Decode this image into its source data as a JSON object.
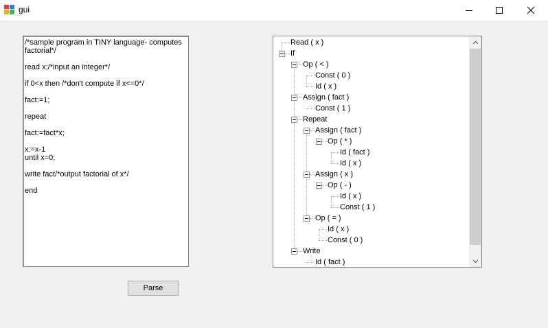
{
  "window": {
    "title": "gui"
  },
  "source": {
    "lines": [
      "/*sample program in TINY language- computes factorial*/",
      "",
      "read x;/*input an integer*/",
      "",
      "if 0<x then /*don't compute if x<=0*/",
      "",
      "fact:=1;",
      "",
      "repeat",
      "",
      "fact:=fact*x;",
      "",
      "x:=x-1",
      "until x=0;",
      "",
      "write fact/*output factorial of x*/",
      "",
      "end"
    ]
  },
  "parse_button": {
    "label": "Parse"
  },
  "tree": {
    "nodes": [
      {
        "label": "Read ( x )",
        "depth": 0,
        "expanded": false
      },
      {
        "label": "If",
        "depth": 0,
        "expanded": true
      },
      {
        "label": "Op ( < )",
        "depth": 1,
        "expanded": true
      },
      {
        "label": "Const ( 0 )",
        "depth": 2,
        "expanded": false
      },
      {
        "label": "Id ( x )",
        "depth": 2,
        "expanded": false
      },
      {
        "label": "Assign ( fact )",
        "depth": 1,
        "expanded": true
      },
      {
        "label": "Const ( 1 )",
        "depth": 2,
        "expanded": false
      },
      {
        "label": "Repeat",
        "depth": 1,
        "expanded": true
      },
      {
        "label": "Assign ( fact )",
        "depth": 2,
        "expanded": true
      },
      {
        "label": "Op ( * )",
        "depth": 3,
        "expanded": true
      },
      {
        "label": "Id ( fact )",
        "depth": 4,
        "expanded": false
      },
      {
        "label": "Id ( x )",
        "depth": 4,
        "expanded": false
      },
      {
        "label": "Assign ( x )",
        "depth": 2,
        "expanded": true
      },
      {
        "label": "Op ( - )",
        "depth": 3,
        "expanded": true
      },
      {
        "label": "Id ( x )",
        "depth": 4,
        "expanded": false
      },
      {
        "label": "Const ( 1 )",
        "depth": 4,
        "expanded": false
      },
      {
        "label": "Op ( = )",
        "depth": 2,
        "expanded": true
      },
      {
        "label": "Id ( x )",
        "depth": 3,
        "expanded": false
      },
      {
        "label": "Const ( 0 )",
        "depth": 3,
        "expanded": false
      },
      {
        "label": "Write",
        "depth": 1,
        "expanded": true
      },
      {
        "label": "Id ( fact )",
        "depth": 2,
        "expanded": false
      }
    ]
  },
  "icons": {
    "app": "app-icon",
    "minimize": "minimize-icon",
    "maximize": "maximize-icon",
    "close": "close-icon",
    "scroll_up": "chevron-up-icon",
    "scroll_down": "chevron-down-icon"
  }
}
